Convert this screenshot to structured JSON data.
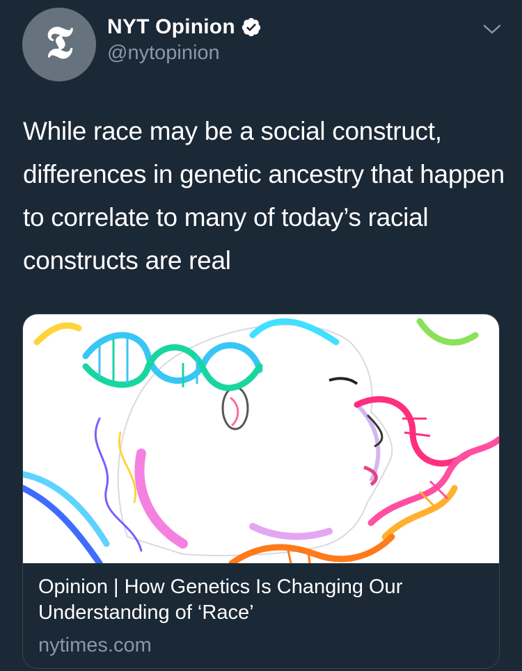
{
  "author": {
    "avatar_glyph": "ᴛ",
    "display_name": "NYT Opinion",
    "handle": "@nytopinion",
    "verified": true
  },
  "tweet": {
    "text": "While race may be a social construct, differences in genetic ancestry that happen to correlate to many of today’s racial constructs are real"
  },
  "card": {
    "title": "Opinion | How Genetics Is Changing Our Understanding of ‘Race’",
    "domain": "nytimes.com",
    "image_subject": "illustration-head-dna-strands"
  },
  "colors": {
    "background": "#1b2836",
    "border": "#38444d",
    "secondary_text": "#8899a6",
    "avatar_bg": "#66737f"
  },
  "icons": {
    "verified": "verified-check-icon",
    "menu": "chevron-down-icon"
  }
}
